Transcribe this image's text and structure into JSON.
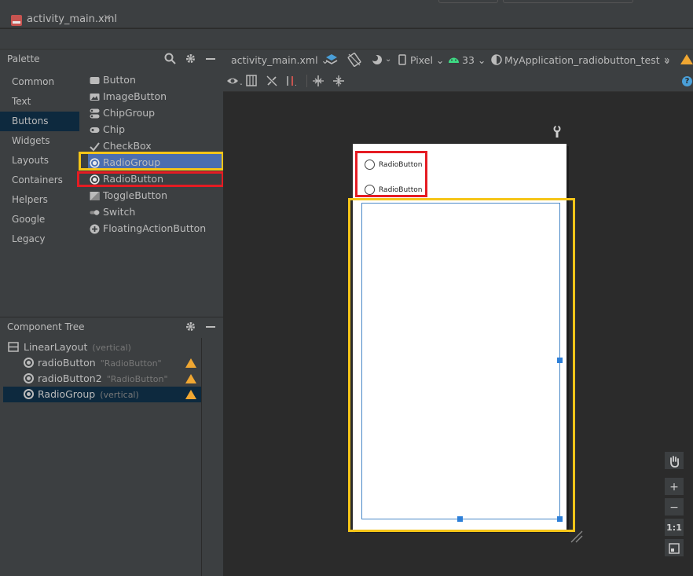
{
  "editor_tab": {
    "file_name": "activity_main.xml",
    "close_glyph": "✕"
  },
  "palette": {
    "title": "Palette",
    "categories": [
      "Common",
      "Text",
      "Buttons",
      "Widgets",
      "Layouts",
      "Containers",
      "Helpers",
      "Google",
      "Legacy"
    ],
    "selected_category": "Buttons",
    "items": [
      {
        "label": "Button",
        "icon": "button-icon"
      },
      {
        "label": "ImageButton",
        "icon": "image-button-icon"
      },
      {
        "label": "ChipGroup",
        "icon": "chip-group-icon"
      },
      {
        "label": "Chip",
        "icon": "chip-icon"
      },
      {
        "label": "CheckBox",
        "icon": "checkbox-icon"
      },
      {
        "label": "RadioGroup",
        "icon": "radio-group-icon"
      },
      {
        "label": "RadioButton",
        "icon": "radio-button-icon"
      },
      {
        "label": "ToggleButton",
        "icon": "toggle-button-icon"
      },
      {
        "label": "Switch",
        "icon": "switch-icon"
      },
      {
        "label": "FloatingActionButton",
        "icon": "fab-icon"
      }
    ],
    "selected_item": "RadioGroup"
  },
  "component_tree": {
    "title": "Component Tree",
    "root": {
      "label": "LinearLayout",
      "sub": "(vertical)"
    },
    "children": [
      {
        "label": "radioButton",
        "sub": "\"RadioButton\"",
        "warning": true
      },
      {
        "label": "radioButton2",
        "sub": "\"RadioButton\"",
        "warning": true
      },
      {
        "label": "RadioGroup",
        "sub": "(vertical)",
        "warning": true
      }
    ]
  },
  "design_toolbar": {
    "file_dropdown": "activity_main.xml",
    "device": "Pixel",
    "api_level": "33",
    "theme": "MyApplication_radiobutton_test",
    "overflow": "»"
  },
  "preview": {
    "radio_buttons": [
      "RadioButton",
      "RadioButton"
    ]
  },
  "zoom_controls": {
    "zoom_in": "+",
    "zoom_out": "−",
    "actual_size": "1:1"
  },
  "colors": {
    "highlight_yellow": "#f5c518",
    "highlight_red": "#e51c23",
    "selection_blue": "#4b6eaf",
    "warning": "#f0a732"
  }
}
